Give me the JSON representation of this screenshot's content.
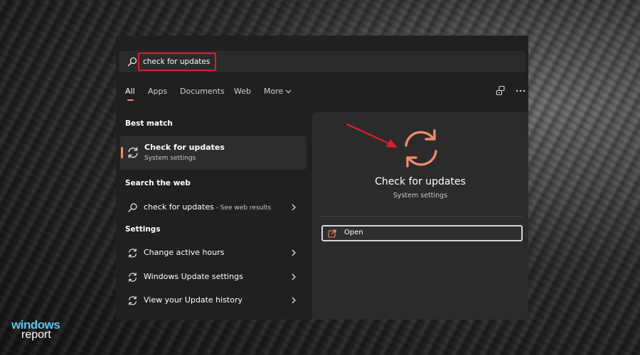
{
  "search": {
    "query": "check for updates"
  },
  "tabs": [
    {
      "label": "All",
      "active": true
    },
    {
      "label": "Apps",
      "active": false
    },
    {
      "label": "Documents",
      "active": false
    },
    {
      "label": "Web",
      "active": false
    },
    {
      "label": "More",
      "active": false
    }
  ],
  "sections": {
    "best_match": "Best match",
    "search_web": "Search the web",
    "settings": "Settings"
  },
  "best_match": {
    "title": "Check for updates",
    "subtitle": "System settings",
    "icon": "sync-icon"
  },
  "web_result": {
    "query": "check for updates",
    "hint": " - See web results",
    "icon": "search-icon"
  },
  "settings_items": [
    {
      "label": "Change active hours",
      "icon": "sync-icon"
    },
    {
      "label": "Windows Update settings",
      "icon": "sync-icon"
    },
    {
      "label": "View your Update history",
      "icon": "sync-icon"
    }
  ],
  "preview": {
    "title": "Check for updates",
    "subtitle": "System settings",
    "open_label": "Open",
    "icon": "sync-icon"
  },
  "logo": {
    "line1": "windows",
    "line2": "report"
  },
  "colors": {
    "accent": "#f08a6a",
    "highlight_box": "#d8202a",
    "annotation_arrow": "#d8202a",
    "logo_blue": "#5fc5ee"
  }
}
